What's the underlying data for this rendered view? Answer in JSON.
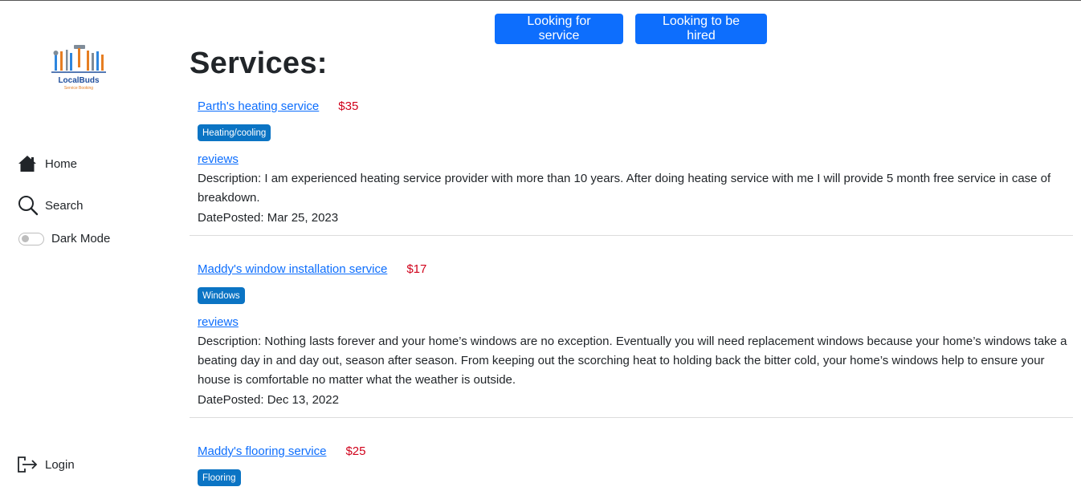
{
  "sidebar": {
    "logo_text": "LocalBuds",
    "logo_tagline": "Service Booking",
    "home_label": "Home",
    "search_label": "Search",
    "dark_mode_label": "Dark Mode",
    "dark_mode_on": false,
    "login_label": "Login"
  },
  "header": {
    "btn_service": "Looking for service",
    "btn_hired": "Looking to be hired"
  },
  "main": {
    "title": "Services:",
    "listings": [
      {
        "name": "Parth's heating service",
        "price": "$35",
        "category": "Heating/cooling",
        "reviews_label": "reviews",
        "description": "Description: I am experienced heating service provider with more than 10 years. After doing heating service with me I will provide 5 month free service in case of breakdown.",
        "date": "DatePosted: Mar 25, 2023"
      },
      {
        "name": "Maddy's window installation service",
        "price": "$17",
        "category": "Windows",
        "reviews_label": "reviews",
        "description": "Description: Nothing lasts forever and your home’s windows are no exception. Eventually you will need replacement windows because your home’s windows take a beating day in and day out, season after season. From keeping out the scorching heat to holding back the bitter cold, your home’s windows help to ensure your house is comfortable no matter what the weather is outside.",
        "date": "DatePosted: Dec 13, 2022"
      },
      {
        "name": "Maddy's flooring service",
        "price": "$25",
        "category": "Flooring"
      }
    ]
  },
  "colors": {
    "primary": "#0d6efd",
    "badge": "#0b74c4",
    "price": "#d0021b",
    "text": "#212529"
  },
  "icons": {
    "home": "home-icon",
    "search": "search-icon",
    "login": "login-icon",
    "toggle": "toggle-switch"
  }
}
